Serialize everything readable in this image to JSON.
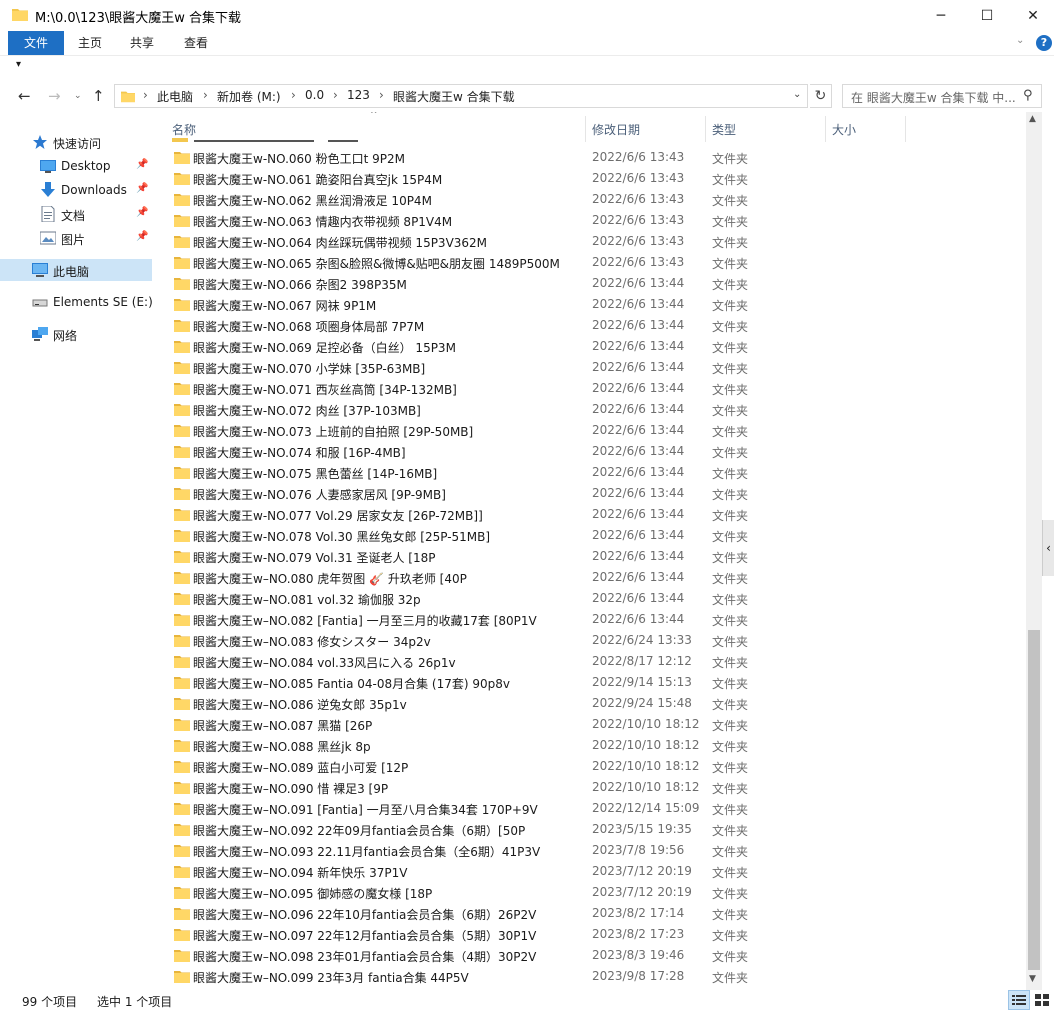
{
  "window": {
    "title": "M:\\0.0\\123\\眼酱大魔王w 合集下载",
    "min_glyph": "─",
    "max_glyph": "☐",
    "close_glyph": "✕"
  },
  "ribbon": {
    "tabs": [
      "文件",
      "主页",
      "共享",
      "查看"
    ],
    "expand_glyph": "⌄",
    "help_glyph": "?"
  },
  "qat": {
    "dropdown_glyph": "▾"
  },
  "nav": {
    "back": "←",
    "forward": "→",
    "history": "⌄",
    "up": "↑"
  },
  "address": {
    "crumbs": [
      "此电脑",
      "新加卷 (M:)",
      "0.0",
      "123",
      "眼酱大魔王w 合集下载"
    ],
    "separator": "›",
    "lead_separator": "›",
    "dropdown_glyph": "⌄",
    "refresh_glyph": "↻"
  },
  "search": {
    "placeholder": "在 眼酱大魔王w 合集下载 中...",
    "icon": "search-icon",
    "glyph": "⚲"
  },
  "sidebar": {
    "quick_access": "快速访问",
    "items": [
      {
        "label": "Desktop",
        "icon": "desktop-icon",
        "pinned": true
      },
      {
        "label": "Downloads",
        "icon": "downloads-icon",
        "pinned": true
      },
      {
        "label": "文档",
        "icon": "documents-icon",
        "pinned": true
      },
      {
        "label": "图片",
        "icon": "pictures-icon",
        "pinned": true
      }
    ],
    "this_pc": "此电脑",
    "drive": "Elements SE (E:)",
    "network": "网络",
    "pin_glyph": "📌"
  },
  "columns": {
    "name": "名称",
    "date": "修改日期",
    "type": "类型",
    "size": "大小",
    "sort_glyph": "^"
  },
  "files": [
    {
      "name": "眼酱大魔王w-NO.060 粉色工口t 9P2M",
      "date": "2022/6/6 13:43",
      "type": "文件夹"
    },
    {
      "name": "眼酱大魔王w-NO.061 跪姿阳台真空jk 15P4M",
      "date": "2022/6/6 13:43",
      "type": "文件夹"
    },
    {
      "name": "眼酱大魔王w-NO.062 黑丝润滑液足 10P4M",
      "date": "2022/6/6 13:43",
      "type": "文件夹"
    },
    {
      "name": "眼酱大魔王w-NO.063 情趣内衣带视频 8P1V4M",
      "date": "2022/6/6 13:43",
      "type": "文件夹"
    },
    {
      "name": "眼酱大魔王w-NO.064 肉丝踩玩偶带视频 15P3V362M",
      "date": "2022/6/6 13:43",
      "type": "文件夹"
    },
    {
      "name": "眼酱大魔王w-NO.065 杂图&脸照&微博&贴吧&朋友圈 1489P500M",
      "date": "2022/6/6 13:43",
      "type": "文件夹"
    },
    {
      "name": "眼酱大魔王w-NO.066 杂图2 398P35M",
      "date": "2022/6/6 13:44",
      "type": "文件夹"
    },
    {
      "name": "眼酱大魔王w-NO.067 网袜 9P1M",
      "date": "2022/6/6 13:44",
      "type": "文件夹"
    },
    {
      "name": "眼酱大魔王w-NO.068 项圈身体局部 7P7M",
      "date": "2022/6/6 13:44",
      "type": "文件夹"
    },
    {
      "name": "眼酱大魔王w-NO.069 足控必备（白丝） 15P3M",
      "date": "2022/6/6 13:44",
      "type": "文件夹"
    },
    {
      "name": "眼酱大魔王w-NO.070 小学妹 [35P-63MB]",
      "date": "2022/6/6 13:44",
      "type": "文件夹"
    },
    {
      "name": "眼酱大魔王w-NO.071 西灰丝高筒 [34P-132MB]",
      "date": "2022/6/6 13:44",
      "type": "文件夹"
    },
    {
      "name": "眼酱大魔王w-NO.072 肉丝 [37P-103MB]",
      "date": "2022/6/6 13:44",
      "type": "文件夹"
    },
    {
      "name": "眼酱大魔王w-NO.073 上班前的自拍照 [29P-50MB]",
      "date": "2022/6/6 13:44",
      "type": "文件夹"
    },
    {
      "name": "眼酱大魔王w-NO.074 和服 [16P-4MB]",
      "date": "2022/6/6 13:44",
      "type": "文件夹"
    },
    {
      "name": "眼酱大魔王w-NO.075 黑色蕾丝 [14P-16MB]",
      "date": "2022/6/6 13:44",
      "type": "文件夹"
    },
    {
      "name": "眼酱大魔王w-NO.076 人妻感家居风 [9P-9MB]",
      "date": "2022/6/6 13:44",
      "type": "文件夹"
    },
    {
      "name": "眼酱大魔王w-NO.077 Vol.29 居家女友 [26P-72MB]]",
      "date": "2022/6/6 13:44",
      "type": "文件夹"
    },
    {
      "name": "眼酱大魔王w-NO.078 Vol.30 黑丝兔女郎 [25P-51MB]",
      "date": "2022/6/6 13:44",
      "type": "文件夹"
    },
    {
      "name": "眼酱大魔王w-NO.079 Vol.31 圣诞老人 [18P",
      "date": "2022/6/6 13:44",
      "type": "文件夹"
    },
    {
      "name": "眼酱大魔王w–NO.080 虎年贺图 🎸 升玖老师 [40P",
      "date": "2022/6/6 13:44",
      "type": "文件夹"
    },
    {
      "name": "眼酱大魔王w–NO.081 vol.32 瑜伽服 32p",
      "date": "2022/6/6 13:44",
      "type": "文件夹"
    },
    {
      "name": "眼酱大魔王w–NO.082 [Fantia] 一月至三月的收藏17套 [80P1V",
      "date": "2022/6/6 13:44",
      "type": "文件夹"
    },
    {
      "name": "眼酱大魔王w–NO.083 修女シスター 34p2v",
      "date": "2022/6/24 13:33",
      "type": "文件夹"
    },
    {
      "name": "眼酱大魔王w–NO.084 vol.33风吕に入る 26p1v",
      "date": "2022/8/17 12:12",
      "type": "文件夹"
    },
    {
      "name": "眼酱大魔王w–NO.085 Fantia 04-08月合集 (17套) 90p8v",
      "date": "2022/9/14 15:13",
      "type": "文件夹"
    },
    {
      "name": "眼酱大魔王w–NO.086 逆兔女郎 35p1v",
      "date": "2022/9/24 15:48",
      "type": "文件夹"
    },
    {
      "name": "眼酱大魔王w–NO.087 黑猫 [26P",
      "date": "2022/10/10 18:12",
      "type": "文件夹"
    },
    {
      "name": "眼酱大魔王w–NO.088 黑丝jk 8p",
      "date": "2022/10/10 18:12",
      "type": "文件夹"
    },
    {
      "name": "眼酱大魔王w–NO.089 蓝白小可爱 [12P",
      "date": "2022/10/10 18:12",
      "type": "文件夹"
    },
    {
      "name": "眼酱大魔王w–NO.090 惜 裸足3 [9P",
      "date": "2022/10/10 18:12",
      "type": "文件夹"
    },
    {
      "name": "眼酱大魔王w–NO.091 [Fantia] 一月至八月合集34套 170P+9V",
      "date": "2022/12/14 15:09",
      "type": "文件夹"
    },
    {
      "name": "眼酱大魔王w–NO.092 22年09月fantia会员合集（6期）[50P",
      "date": "2023/5/15 19:35",
      "type": "文件夹"
    },
    {
      "name": "眼酱大魔王w–NO.093 22.11月fantia会员合集（全6期）41P3V",
      "date": "2023/7/8 19:56",
      "type": "文件夹"
    },
    {
      "name": "眼酱大魔王w–NO.094 新年快乐 37P1V",
      "date": "2023/7/12 20:19",
      "type": "文件夹"
    },
    {
      "name": "眼酱大魔王w–NO.095 御姉感の魔女様 [18P",
      "date": "2023/7/12 20:19",
      "type": "文件夹"
    },
    {
      "name": "眼酱大魔王w–NO.096 22年10月fantia会员合集（6期）26P2V",
      "date": "2023/8/2 17:14",
      "type": "文件夹"
    },
    {
      "name": "眼酱大魔王w–NO.097 22年12月fantia会员合集（5期）30P1V",
      "date": "2023/8/2 17:23",
      "type": "文件夹"
    },
    {
      "name": "眼酱大魔王w–NO.098 23年01月fantia会员合集（4期）30P2V",
      "date": "2023/8/3 19:46",
      "type": "文件夹"
    },
    {
      "name": "眼酱大魔王w–NO.099 23年3月 fantia合集 44P5V",
      "date": "2023/9/8 17:28",
      "type": "文件夹"
    }
  ],
  "scrollbar": {
    "up_glyph": "▲",
    "down_glyph": "▼",
    "side_glyph": "‹"
  },
  "status": {
    "count": "99 个项目",
    "selection": "选中 1 个项目"
  },
  "colors": {
    "accent": "#1e6fc4",
    "folder": "#f3c74e",
    "selected": "#cce4f7"
  }
}
